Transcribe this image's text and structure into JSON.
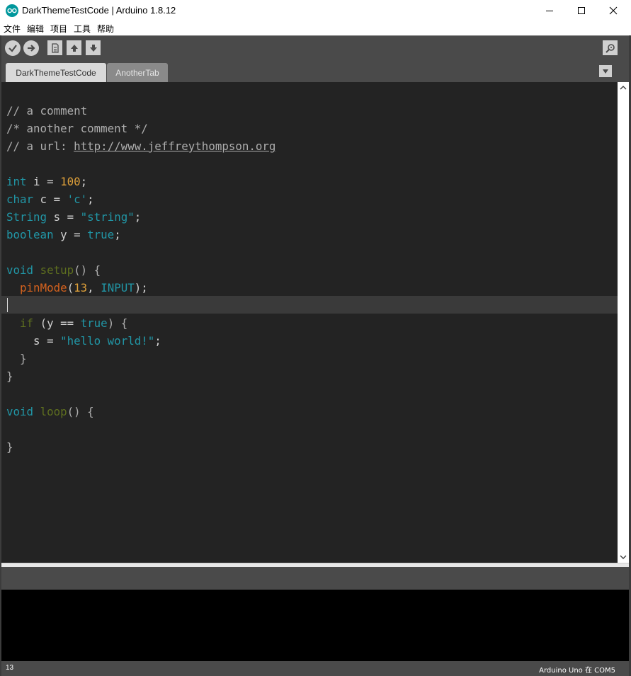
{
  "window": {
    "title": "DarkThemeTestCode | Arduino 1.8.12",
    "icon": "arduino-logo-icon"
  },
  "menu": [
    "文件",
    "编辑",
    "项目",
    "工具",
    "帮助"
  ],
  "toolbar": {
    "buttons": [
      "verify-icon",
      "upload-icon",
      "new-icon",
      "open-icon",
      "save-icon"
    ],
    "right": "serial-monitor-icon"
  },
  "tabs": [
    {
      "label": "DarkThemeTestCode",
      "active": true
    },
    {
      "label": "AnotherTab",
      "active": false
    }
  ],
  "code": {
    "comment1": "// a comment",
    "comment2": "/* another comment */",
    "comment3_prefix": "// a url: ",
    "url": "http://www.jeffreythompson.org",
    "l5": {
      "type": "int",
      "rest": " i = ",
      "num": "100",
      "end": ";"
    },
    "l6": {
      "type": "char",
      "rest": " c = ",
      "str": "'c'",
      "end": ";"
    },
    "l7": {
      "type": "String",
      "rest": " s = ",
      "str": "\"string\"",
      "end": ";"
    },
    "l8": {
      "type": "boolean",
      "rest": " y = ",
      "const": "true",
      "end": ";"
    },
    "l10": {
      "type": "void",
      "fn": "setup",
      "rest": "() {"
    },
    "l11": {
      "fn": "pinMode",
      "open": "(",
      "num": "13",
      "sep": ", ",
      "const": "INPUT",
      "end": ");"
    },
    "l13": {
      "kw": "if",
      "a": " (y == ",
      "const": "true",
      "b": ") {"
    },
    "l14": {
      "a": "s = ",
      "str": "\"hello world!\"",
      "end": ";"
    },
    "l15": "}",
    "l16": "}",
    "l18": {
      "type": "void",
      "fn": "loop",
      "rest": "() {"
    },
    "l20": "}"
  },
  "status": {
    "line": "13",
    "board": "Arduino Uno 在 COM5"
  },
  "colors": {
    "editor_bg": "#232323",
    "toolbar_bg": "#4a4a4a",
    "console_bg": "#000000"
  }
}
